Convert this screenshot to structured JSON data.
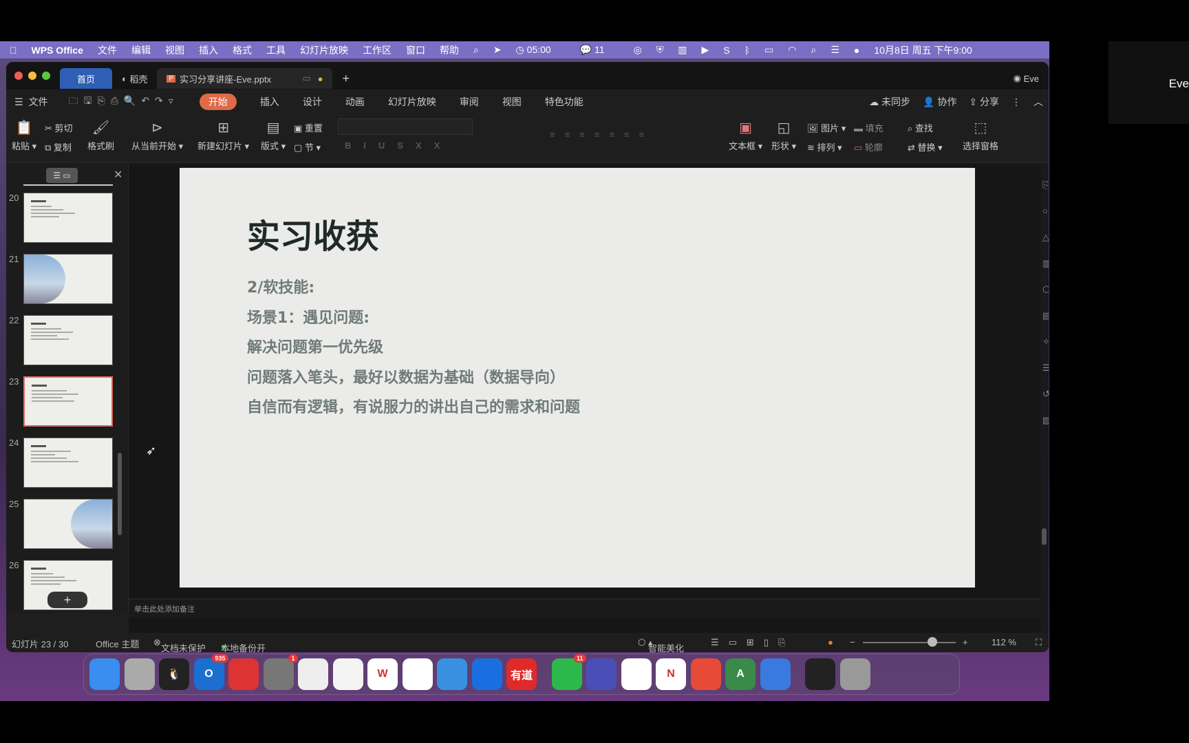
{
  "menubar": {
    "app": "WPS Office",
    "items": [
      "文件",
      "编辑",
      "视图",
      "插入",
      "格式",
      "工具",
      "幻灯片放映",
      "工作区",
      "窗口",
      "帮助"
    ],
    "timer": "05:00",
    "wechat_count": "11",
    "datetime": "10月8日 周五 下午9:00"
  },
  "tabs": {
    "home": "首页",
    "daoke": "稻壳",
    "doc": "实习分享讲座-Eve.pptx",
    "user": "Eve"
  },
  "ribbon": {
    "file": "文件",
    "tabs": [
      "开始",
      "插入",
      "设计",
      "动画",
      "幻灯片放映",
      "审阅",
      "视图",
      "特色功能"
    ],
    "active": "开始",
    "sync": "未同步",
    "collab": "协作",
    "share": "分享"
  },
  "toolbar": {
    "paste": "粘贴",
    "cut": "剪切",
    "copy": "复制",
    "format_painter": "格式刷",
    "play_current": "从当前开始",
    "new_slide": "新建幻灯片",
    "layout": "版式",
    "reset": "重置",
    "section": "节",
    "textbox": "文本框",
    "shape": "形状",
    "picture": "图片",
    "fill": "填充",
    "arrange": "排列",
    "outline": "轮廓",
    "find": "查找",
    "replace": "替换",
    "select_pane": "选择窗格"
  },
  "thumbnails": [
    {
      "num": "20"
    },
    {
      "num": "21"
    },
    {
      "num": "22"
    },
    {
      "num": "23",
      "selected": true
    },
    {
      "num": "24"
    },
    {
      "num": "25"
    },
    {
      "num": "26"
    }
  ],
  "slide": {
    "title": "实习收获",
    "lines": [
      "2/软技能:",
      "场景1：遇见问题:",
      "解决问题第一优先级",
      "问题落入笔头，最好以数据为基础（数据导向）",
      "自信而有逻辑，有说服力的讲出自己的需求和问题"
    ]
  },
  "notes_placeholder": "单击此处添加备注",
  "status": {
    "slide": "幻灯片 23 / 30",
    "theme": "Office 主题",
    "protect": "文档未保护",
    "backup": "本地备份开",
    "beautify": "智能美化",
    "zoom": "112 %",
    "zoom_percent": 112
  },
  "dock": [
    {
      "name": "finder",
      "color": "#3a8ef0"
    },
    {
      "name": "launchpad",
      "color": "#aaa"
    },
    {
      "name": "qq",
      "color": "#222",
      "label": "🐧"
    },
    {
      "name": "outlook",
      "color": "#1a6fd0",
      "label": "O",
      "badge": "935"
    },
    {
      "name": "netease-music",
      "color": "#d33"
    },
    {
      "name": "system-preferences",
      "color": "#777",
      "badge": "1"
    },
    {
      "name": "screenshot",
      "color": "#eee"
    },
    {
      "name": "baidu-netdisk",
      "color": "#f4f4f4"
    },
    {
      "name": "wps",
      "color": "#fff",
      "label": "W"
    },
    {
      "name": "app-dots",
      "color": "#fff"
    },
    {
      "name": "safari",
      "color": "#3a90e0"
    },
    {
      "name": "lark",
      "color": "#1a6fe0"
    },
    {
      "name": "youdao",
      "color": "#e02a2a",
      "label": "有道"
    },
    {
      "name": "wechat",
      "color": "#2cb84a",
      "badge": "11"
    },
    {
      "name": "clock",
      "color": "#4a4fb8"
    },
    {
      "name": "send",
      "color": "#fff"
    },
    {
      "name": "onenote",
      "color": "#fff",
      "label": "N"
    },
    {
      "name": "calendar-todo",
      "color": "#e84a3a"
    },
    {
      "name": "dictionary",
      "color": "#3a8a4a",
      "label": "A"
    },
    {
      "name": "arrow-app",
      "color": "#3a7ae0"
    },
    {
      "name": "window-preview",
      "color": "#222"
    },
    {
      "name": "trash",
      "color": "#999"
    }
  ],
  "rightbox": {
    "label": "Eve"
  },
  "colors": {
    "menubar": "#7a6fc4",
    "active_tab": "#e06a48",
    "home_tab": "#2f5fb5"
  }
}
